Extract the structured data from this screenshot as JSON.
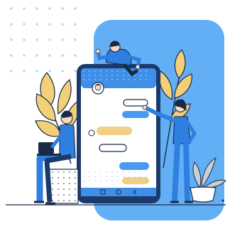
{
  "illustration": {
    "subject": "chat-app-conversation",
    "colors": {
      "panel_blue": "#63aff5",
      "brand_blue": "#2f7fe0",
      "phone_frame": "#1a3a6b",
      "screen_bg": "#ffffff",
      "bubble_blue": "#4a9bf0",
      "bubble_yellow": "#f1cf86",
      "bubble_white": "#ffffff",
      "dot_grid": "#b8daf6",
      "leaf_yellow": "#f2cf78",
      "ink": "#1b2a44",
      "skin": "#f4dcc4",
      "grey_leaf": "#c7cfd7"
    },
    "icons": [
      "nav-back-icon",
      "nav-home-icon",
      "nav-recent-icon",
      "contact-avatar-icon",
      "laptop-icon"
    ],
    "people": [
      "person-peeking-over-phone",
      "person-sitting-with-laptop",
      "person-standing-pointing"
    ]
  }
}
